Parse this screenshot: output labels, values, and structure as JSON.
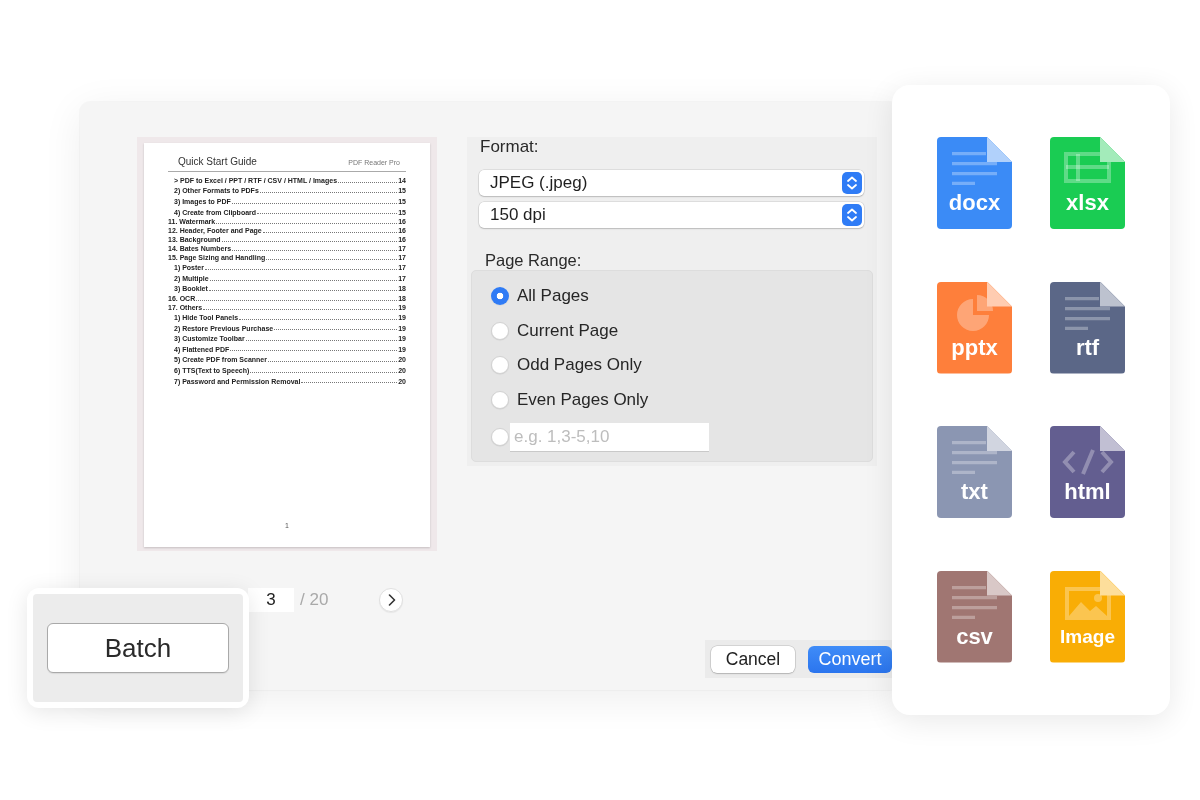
{
  "preview": {
    "title": "Quick Start Guide",
    "header_note": "PDF Reader Pro",
    "toc": [
      {
        "children": [
          {
            "title": "> PDF to Excel / PPT / RTF / CSV / HTML / Images",
            "page": "14"
          },
          {
            "title": "2) Other Formats to PDFs",
            "page": "15"
          },
          {
            "title": "3) Images to PDF",
            "page": "15"
          },
          {
            "title": "4) Create from Clipboard",
            "page": "15"
          }
        ]
      },
      {
        "title": "11. Watermark",
        "page": "16"
      },
      {
        "title": "12. Header, Footer and Page",
        "page": "16"
      },
      {
        "title": "13. Background",
        "page": "16"
      },
      {
        "title": "14. Bates Numbers",
        "page": "17"
      },
      {
        "title": "15. Page Sizing and Handling",
        "page": "17",
        "children": [
          {
            "title": "1) Poster",
            "page": "17"
          },
          {
            "title": "2) Multiple",
            "page": "17"
          },
          {
            "title": "3) Booklet",
            "page": "18"
          }
        ]
      },
      {
        "title": "16. OCR",
        "page": "18"
      },
      {
        "title": "17. Others",
        "page": "19",
        "children": [
          {
            "title": "1) Hide Tool Panels",
            "page": "19"
          },
          {
            "title": "2) Restore Previous Purchase",
            "page": "19"
          },
          {
            "title": "3) Customize Toolbar",
            "page": "19"
          },
          {
            "title": "4) Flattened PDF",
            "page": "19"
          },
          {
            "title": "5) Create PDF from Scanner",
            "page": "20"
          },
          {
            "title": "6) TTS(Text to Speech)",
            "page": "20"
          },
          {
            "title": "7) Password and Permission Removal",
            "page": "20"
          }
        ]
      }
    ],
    "page_number": "1"
  },
  "format": {
    "label": "Format:",
    "file_format": "JPEG (.jpeg)",
    "resolution": "150 dpi"
  },
  "page_range": {
    "label": "Page Range:",
    "options": [
      {
        "kind": "option",
        "label": "All Pages",
        "selected": true
      },
      {
        "kind": "option",
        "label": "Current Page",
        "selected": false
      },
      {
        "kind": "option",
        "label": "Odd Pages Only",
        "selected": false
      },
      {
        "kind": "option",
        "label": "Even Pages Only",
        "selected": false
      },
      {
        "kind": "custom",
        "placeholder": "e.g. 1,3-5,10",
        "selected": false
      }
    ]
  },
  "pagination": {
    "current_page": "3",
    "total": "/ 20"
  },
  "actions": [
    {
      "kind": "secondary",
      "label": "Cancel"
    },
    {
      "kind": "primary",
      "label": "Convert"
    }
  ],
  "batch_button": "Batch",
  "formats": [
    {
      "label": "docx",
      "kind": "document",
      "color": "#3b8bf6"
    },
    {
      "label": "xlsx",
      "kind": "spreadsheet",
      "color": "#1acc53"
    },
    {
      "label": "pptx",
      "kind": "presentation",
      "color": "#fe7f3b"
    },
    {
      "label": "rtf",
      "kind": "document",
      "color": "#5b6787"
    },
    {
      "label": "txt",
      "kind": "document",
      "color": "#8b96b2"
    },
    {
      "label": "html",
      "kind": "code",
      "color": "#635e90"
    },
    {
      "label": "csv",
      "kind": "document",
      "color": "#a07672"
    },
    {
      "label": "Image",
      "kind": "image",
      "color": "#f9ad05"
    }
  ]
}
